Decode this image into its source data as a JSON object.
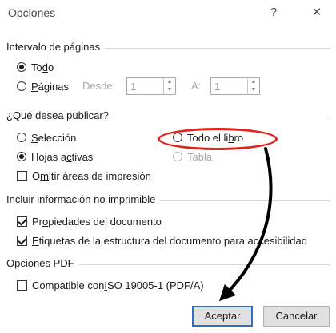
{
  "dialog": {
    "title": "Opciones",
    "help_label": "?",
    "close_label": "✕"
  },
  "range": {
    "header": "Intervalo de páginas",
    "all": {
      "pre": "To",
      "u": "d",
      "post": "o",
      "selected": true
    },
    "pages": {
      "pre": "",
      "u": "P",
      "post": "áginas",
      "selected": false
    },
    "from_label": "Desde:",
    "from_value": "1",
    "to_label": "A:",
    "to_value": "1"
  },
  "publish": {
    "header": "¿Qué desea publicar?",
    "selection": {
      "pre": "",
      "u": "S",
      "post": "elección",
      "selected": false
    },
    "whole_book": {
      "pre": "Todo el li",
      "u": "b",
      "post": "ro",
      "selected": false
    },
    "active_sheets": {
      "pre": "Hojas a",
      "u": "c",
      "post": "tivas",
      "selected": true
    },
    "table": {
      "label": "Tabla",
      "enabled": false
    },
    "ignore_print_areas": {
      "pre": "O",
      "u": "m",
      "post": "itir áreas de impresión",
      "checked": false
    }
  },
  "nonprint": {
    "header": "Incluir información no imprimible",
    "doc_props": {
      "pre": "Pr",
      "u": "o",
      "post": "piedades del documento",
      "checked": true
    },
    "struct_tags": {
      "pre": "",
      "u": "E",
      "post": "tiquetas de la estructura del documento para accesibilidad",
      "checked": true
    }
  },
  "pdf": {
    "header": "Opciones PDF",
    "iso": {
      "pre": "Compatible con ",
      "u": "I",
      "post": "SO 19005-1 (PDF/A)",
      "checked": false
    }
  },
  "buttons": {
    "accept": "Aceptar",
    "cancel": "Cancelar"
  },
  "colors": {
    "highlight": "#e2231a",
    "default_button_border": "#2f6ec0",
    "arrow": "#000000"
  }
}
